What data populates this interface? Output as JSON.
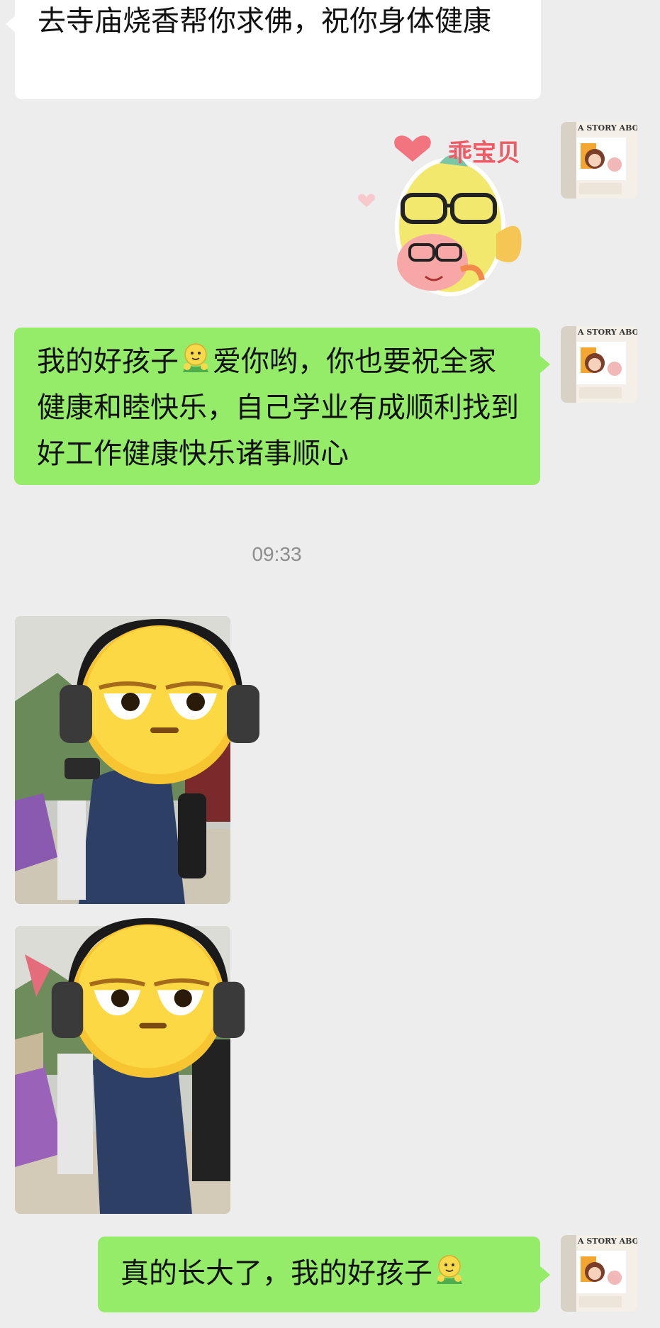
{
  "chat": {
    "messages": [
      {
        "id": "m1",
        "side": "incoming",
        "type": "text",
        "text": "去寺庙烧香帮你求佛，祝你身体健康"
      },
      {
        "id": "m2",
        "side": "outgoing",
        "type": "sticker",
        "caption": "乖宝贝"
      },
      {
        "id": "m3",
        "side": "outgoing",
        "type": "text",
        "text_parts": [
          "我的好孩子",
          "爱你哟，你也要祝全家健康和睦快乐，自己学业有成顺利找到好工作健康快乐诸事顺心"
        ],
        "emoji": "hug-emoji"
      },
      {
        "id": "ts1",
        "type": "timestamp",
        "text": "09:33"
      },
      {
        "id": "m4",
        "side": "incoming",
        "type": "photo",
        "description_icon": "headphones-sleepy-emoji"
      },
      {
        "id": "m5",
        "side": "incoming",
        "type": "photo",
        "description_icon": "headphones-sleepy-emoji"
      },
      {
        "id": "m6",
        "side": "outgoing",
        "type": "text",
        "text_parts": [
          "真的长大了，我的好孩子",
          ""
        ],
        "emoji": "hug-emoji"
      }
    ],
    "avatar_text": "A STORY ABOUT U"
  },
  "colors": {
    "background": "#ededed",
    "incoming_bubble": "#ffffff",
    "outgoing_bubble": "#95ec69",
    "timestamp_text": "#8d8d8d"
  }
}
